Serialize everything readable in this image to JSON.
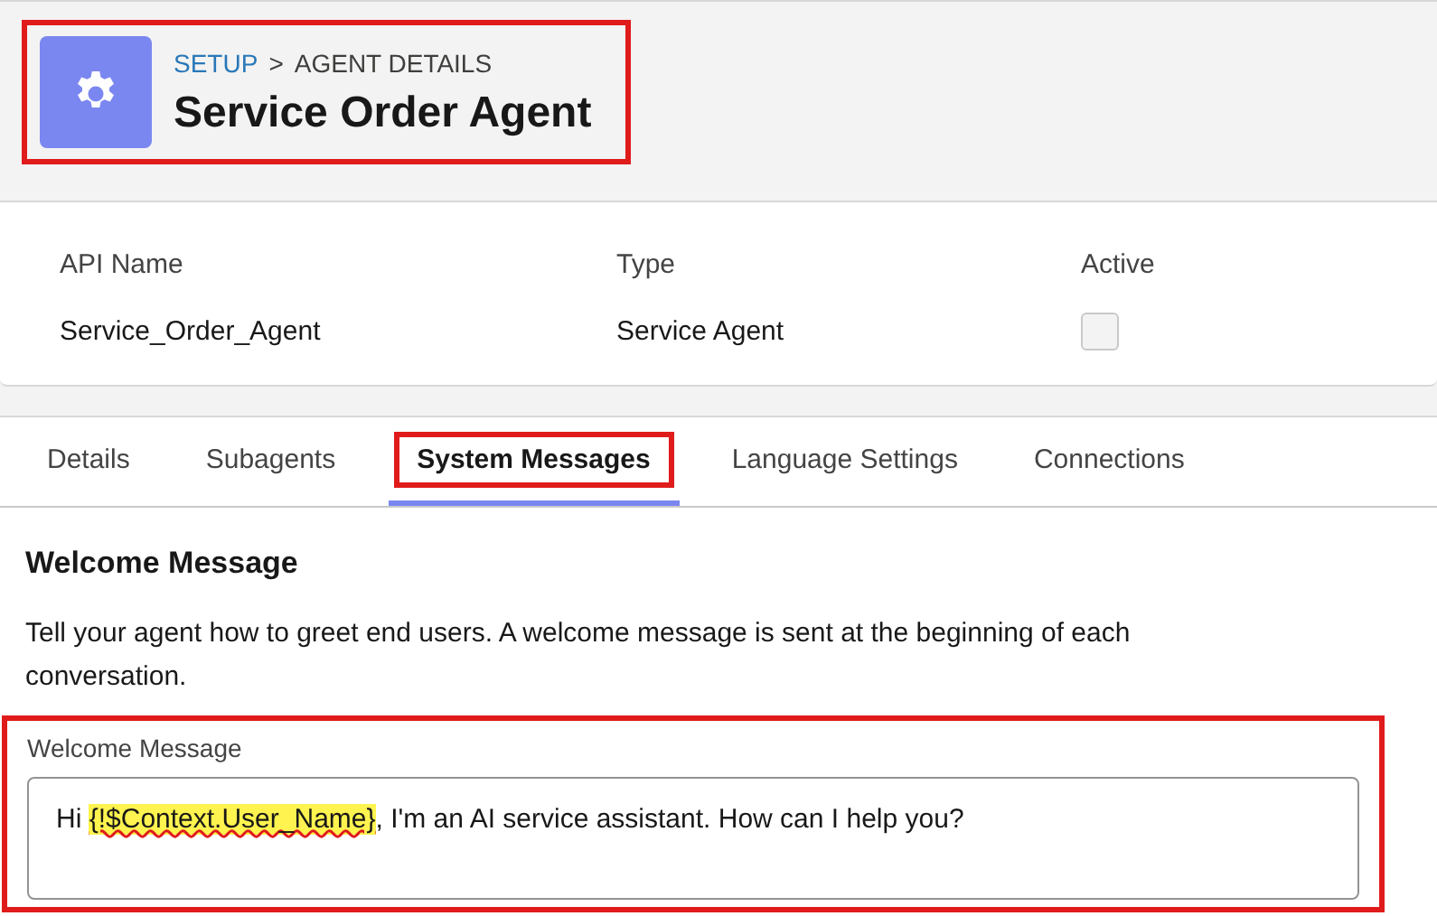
{
  "header": {
    "breadcrumb": [
      {
        "label": "SETUP",
        "link": true
      },
      {
        "label": ">",
        "link": false
      },
      {
        "label": "AGENT DETAILS",
        "link": false
      }
    ],
    "title": "Service Order Agent",
    "highlighted": true
  },
  "fields": [
    {
      "label": "API Name",
      "value": "Service_Order_Agent",
      "kind": "text"
    },
    {
      "label": "Type",
      "value": "Service Agent",
      "kind": "text"
    },
    {
      "label": "Active",
      "kind": "checkbox",
      "checked": false
    }
  ],
  "tabs": [
    {
      "label": "Details",
      "selected": false,
      "highlighted": false
    },
    {
      "label": "Subagents",
      "selected": false,
      "highlighted": false
    },
    {
      "label": "System Messages",
      "selected": true,
      "highlighted": true
    },
    {
      "label": "Language Settings",
      "selected": false,
      "highlighted": false
    },
    {
      "label": "Connections",
      "selected": false,
      "highlighted": false
    }
  ],
  "section": {
    "title": "Welcome Message",
    "description": "Tell your agent how to greet end users. A welcome message is sent at the beginning of each conversation."
  },
  "welcome_field": {
    "label": "Welcome Message",
    "highlighted": true,
    "value": [
      {
        "text": "Hi ",
        "kind": "plain"
      },
      {
        "text": "{!$Context.User_Name}",
        "kind": "highlight"
      },
      {
        "text": ", I'm an AI service assistant. How can I help you?",
        "kind": "plain"
      }
    ]
  }
}
